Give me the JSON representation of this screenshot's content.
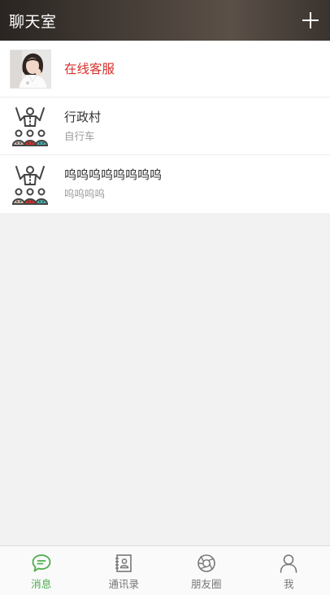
{
  "header": {
    "title": "聊天室"
  },
  "chats": [
    {
      "name": "在线客服",
      "subtitle": "",
      "avatar": "person-photo",
      "highlight_color": "#d8302a"
    },
    {
      "name": "行政村",
      "subtitle": "自行车",
      "avatar": "group-people-icon"
    },
    {
      "name": "呜呜呜呜呜呜呜呜",
      "subtitle": "呜呜呜呜",
      "avatar": "group-people-icon"
    }
  ],
  "tabbar": {
    "tabs": [
      {
        "label": "消息",
        "icon": "message-icon",
        "active": true
      },
      {
        "label": "通讯录",
        "icon": "contacts-icon",
        "active": false
      },
      {
        "label": "朋友圈",
        "icon": "moments-icon",
        "active": false
      },
      {
        "label": "我",
        "icon": "person-icon",
        "active": false
      }
    ],
    "active_color": "#4cae4c",
    "inactive_color": "#777777"
  },
  "colors": {
    "header_bg": "#3d3631",
    "page_bg": "#f2f2f2"
  }
}
